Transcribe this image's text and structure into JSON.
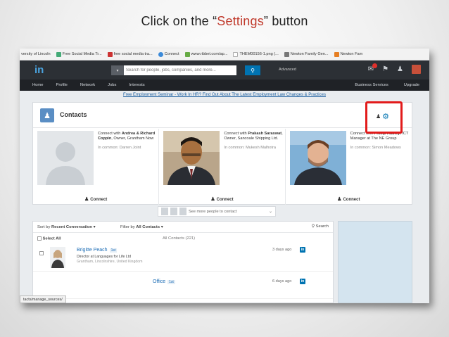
{
  "instruction": {
    "prefix": "Click on the “",
    "highlight": "Settings",
    "suffix": "” button",
    "highlight_color": "#c0392b"
  },
  "bookmarks": [
    {
      "label": "versity of Lincoln",
      "color": "#ffffff"
    },
    {
      "label": "Free Social Media Tr...",
      "color": "#4a7"
    },
    {
      "label": "free social media tra...",
      "color": "#c33"
    },
    {
      "label": "Connect",
      "color": "#3b8ad9"
    },
    {
      "label": "www.ribbet.com/ap...",
      "color": "#6a4"
    },
    {
      "label": "THEM00156-1.png (...",
      "color": "#aaa"
    },
    {
      "label": "Newton Family Gen...",
      "color": "#777"
    },
    {
      "label": "Newton Fam",
      "color": "#e67e22"
    }
  ],
  "header": {
    "logo": "in",
    "search_placeholder": "Search for people, jobs, companies, and more...",
    "advanced": "Advanced",
    "nav": [
      "Home",
      "Profile",
      "Network",
      "Jobs",
      "Interests"
    ],
    "nav_right": [
      "Business Services",
      "Upgrade"
    ]
  },
  "promo": "Free Employment Seminar - Work In HR? Find Out About The Latest Employment Law Changes & Practices",
  "contacts": {
    "title": "Contacts",
    "suggestions": [
      {
        "connect_with": "Connect with ",
        "name": "Andrea & Richard Coppin",
        "role": ", Owner, Grantham Now",
        "in_common": "In common: Darren Joint",
        "button": "Connect"
      },
      {
        "connect_with": "Connect with ",
        "name": "Prakash Saraswat",
        "role": ", Owner, Sancoale Shipping Ltd.",
        "in_common": "In common: Mukesh Malhotra",
        "button": "Connect"
      },
      {
        "connect_with": "Connect with ",
        "name": "Phillip Hadley",
        "role": ", ICT Manager at The NE Group",
        "in_common": "In common: Simon Meadows",
        "button": "Connect"
      }
    ],
    "see_more": "See more people to contact"
  },
  "list": {
    "sort_label": "Sort by ",
    "sort_value": "Recent Conversation",
    "filter_label": "Filter by ",
    "filter_value": "All Contacts",
    "search_label": "Search",
    "select_all": "Select All",
    "all_contacts": "All Contacts (221)",
    "rows": [
      {
        "name": "Brigitte Peach",
        "degree": "1st",
        "title": "Director at Languages for Life Ltd",
        "location": "Grantham, Lincolnshire, United Kingdom",
        "when": "3 days ago"
      },
      {
        "name": "Office",
        "degree": "1st",
        "title": "",
        "location": "",
        "when": "6 days ago"
      }
    ]
  },
  "status_url": "tacts/manage_sources/"
}
